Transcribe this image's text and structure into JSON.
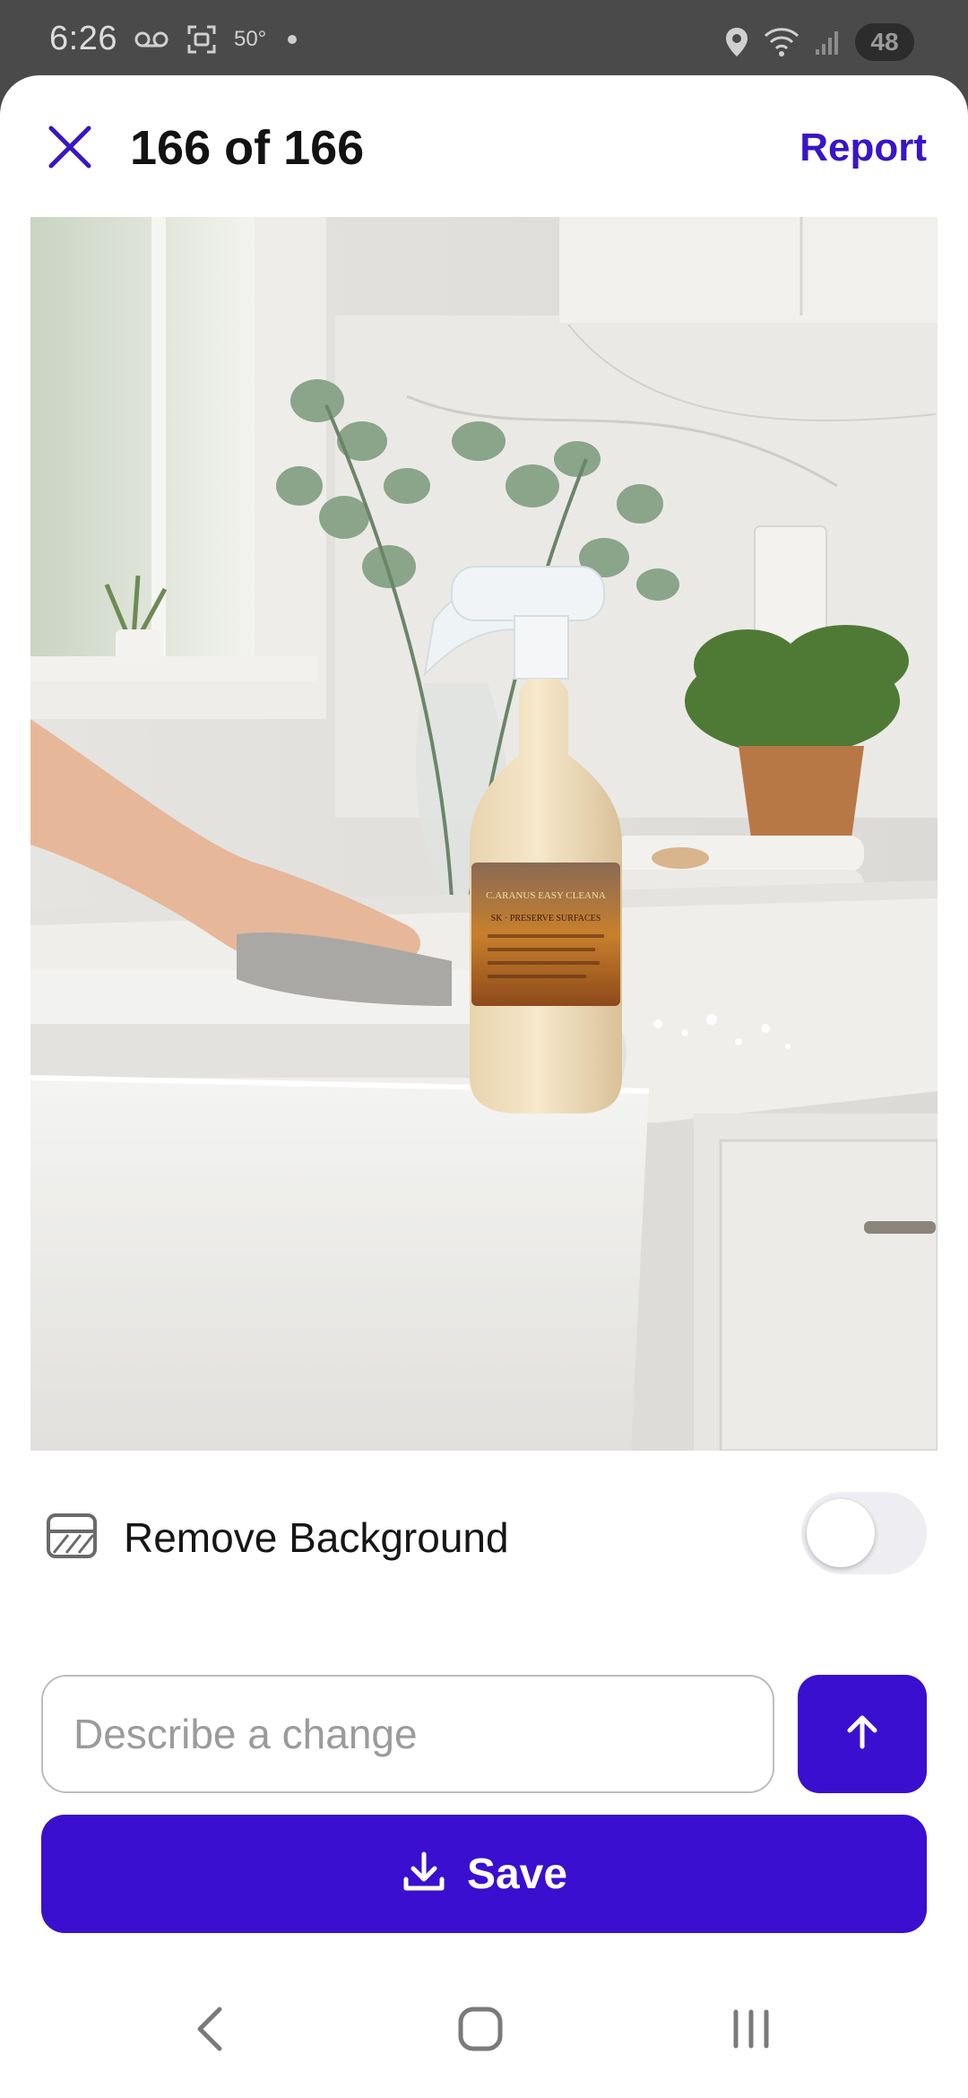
{
  "status_bar": {
    "time": "6:26",
    "temperature": "50°",
    "battery": "48",
    "icons": [
      "voicemail-icon",
      "screenshot-icon",
      "location-icon",
      "wifi-icon",
      "signal-icon"
    ]
  },
  "header": {
    "counter": "166 of 166",
    "report_label": "Report",
    "close_icon": "close-icon"
  },
  "image": {
    "subject": "spray-bottle-on-kitchen-counter"
  },
  "remove_background": {
    "label": "Remove Background",
    "enabled": false,
    "icon": "remove-background-icon"
  },
  "prompt": {
    "placeholder": "Describe a change",
    "value": "",
    "send_icon": "arrow-up-icon"
  },
  "save": {
    "label": "Save",
    "icon": "download-icon"
  },
  "nav": {
    "items": [
      "back-icon",
      "home-icon",
      "recent-apps-icon"
    ]
  },
  "colors": {
    "accent": "#3a0fd0",
    "report_text": "#3a14c8",
    "status_bar_bg": "#4a4a4a"
  }
}
